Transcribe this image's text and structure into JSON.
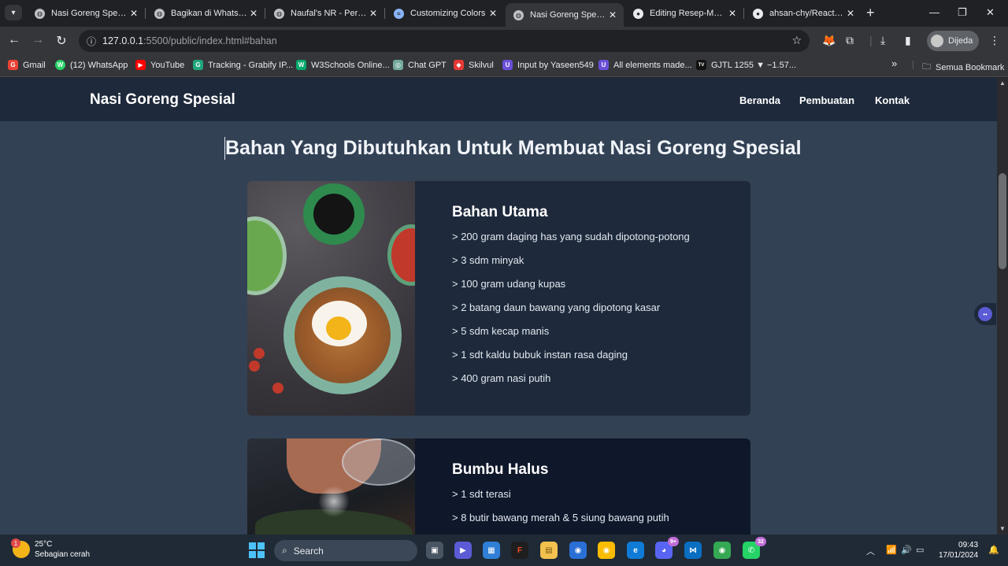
{
  "browser": {
    "tabs": [
      {
        "title": "Nasi Goreng Spesial",
        "active": false
      },
      {
        "title": "Bagikan di WhatsApp",
        "active": false
      },
      {
        "title": "Naufal's NR - Personal",
        "active": false
      },
      {
        "title": "Customizing Colors",
        "active": false
      },
      {
        "title": "Nasi Goreng Spesial",
        "active": true
      },
      {
        "title": "Editing Resep-Makan",
        "active": false
      },
      {
        "title": "ahsan-chy/React-JS",
        "active": false
      }
    ],
    "url_host": "127.0.0.1",
    "url_rest": ":5500/public/index.html#bahan",
    "profile_label": "Dijeda",
    "bookmarks": [
      {
        "label": "Gmail",
        "color": "#ea4335",
        "glyph": "G"
      },
      {
        "label": "(12) WhatsApp",
        "color": "#25d366",
        "glyph": "W"
      },
      {
        "label": "YouTube",
        "color": "#ff0000",
        "glyph": "▶"
      },
      {
        "label": "Tracking - Grabify IP...",
        "color": "#1fa67a",
        "glyph": "G"
      },
      {
        "label": "W3Schools Online...",
        "color": "#04aa6d",
        "glyph": "W"
      },
      {
        "label": "Chat GPT",
        "color": "#74aa9c",
        "glyph": "◎"
      },
      {
        "label": "Skilvul",
        "color": "#e53935",
        "glyph": "◆"
      },
      {
        "label": "Input by Yaseen549",
        "color": "#6b4fd8",
        "glyph": "U"
      },
      {
        "label": "All elements made...",
        "color": "#6b4fd8",
        "glyph": "U"
      },
      {
        "label": "GJTL 1255 ▼ −1.57...",
        "color": "#111111",
        "glyph": "TV"
      }
    ],
    "bookmarks_overflow": "»",
    "all_bookmarks": "Semua Bookmark"
  },
  "site": {
    "brand": "Nasi Goreng Spesial",
    "nav": [
      "Beranda",
      "Pembuatan",
      "Kontak"
    ],
    "heading": "Bahan Yang Dibutuhkan Untuk Membuat Nasi Goreng Spesial",
    "cards": [
      {
        "title": "Bahan Utama",
        "items": [
          "> 200 gram daging has yang sudah dipotong-potong",
          "> 3 sdm minyak",
          "> 100 gram udang kupas",
          "> 2 batang daun bawang yang dipotong kasar",
          "> 5 sdm kecap manis",
          "> 1 sdt kaldu bubuk instan rasa daging",
          "> 400 gram nasi putih"
        ]
      },
      {
        "title": "Bumbu Halus",
        "items": [
          "> 1 sdt terasi",
          "> 8 butir bawang merah & 5 siung bawang putih"
        ]
      }
    ]
  },
  "taskbar": {
    "temperature": "25°C",
    "weather": "Sebagian cerah",
    "weather_badge": "1",
    "search_placeholder": "Search",
    "time": "09:43",
    "date": "17/01/2024",
    "badges": {
      "discord": "9+",
      "whatsapp": "32"
    }
  },
  "colors": {
    "page_bg": "#334155",
    "nav_bg": "#1e293b",
    "card1_bg": "#1e293b",
    "card2_bg": "#0f172a"
  }
}
